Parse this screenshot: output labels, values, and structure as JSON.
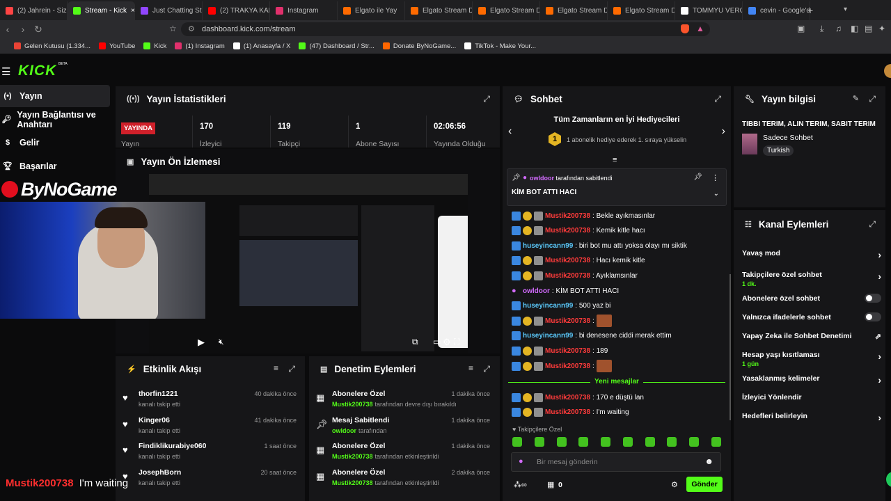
{
  "browser": {
    "tabs": [
      {
        "label": "(2) Jahrein - Siz B",
        "color": "#ff4444"
      },
      {
        "label": "Stream - Kick",
        "color": "#53fc18",
        "active": true
      },
      {
        "label": "Just Chatting Str",
        "color": "#9146ff"
      },
      {
        "label": "(2) TRAKYA KARS",
        "color": "#ff0000"
      },
      {
        "label": "Instagram",
        "color": "#e1306c"
      },
      {
        "label": "Elgato ile Yay",
        "color": "#ff6a00"
      },
      {
        "label": "Elgato Stream De",
        "color": "#ff6a00"
      },
      {
        "label": "Elgato Stream De",
        "color": "#ff6a00"
      },
      {
        "label": "Elgato Stream De",
        "color": "#ff6a00"
      },
      {
        "label": "Elgato Stream De",
        "color": "#ff6a00"
      },
      {
        "label": "TOMMYU VERCE",
        "color": "#ffffff"
      },
      {
        "label": "cevin - Google'd",
        "color": "#4285f4"
      }
    ],
    "url": "dashboard.kick.com/stream",
    "bookmarks": [
      {
        "label": "Gelen Kutusu (1.334...",
        "color": "#ea4335"
      },
      {
        "label": "YouTube",
        "color": "#ff0000"
      },
      {
        "label": "Kick",
        "color": "#53fc18"
      },
      {
        "label": "(1) Instagram",
        "color": "#e1306c"
      },
      {
        "label": "(1) Anasayfa / X",
        "color": "#ffffff"
      },
      {
        "label": "(47) Dashboard / Str...",
        "color": "#53fc18"
      },
      {
        "label": "Donate ByNoGame...",
        "color": "#ff6600"
      },
      {
        "label": "TikTok - Make Your...",
        "color": "#ffffff"
      }
    ]
  },
  "app": {
    "logo": "KICK",
    "beta": "BETA",
    "nav": [
      {
        "label": "Yayın",
        "icon": "broadcast-icon"
      },
      {
        "label": "Yayın Bağlantısı ve Anahtarı",
        "icon": "key-icon"
      },
      {
        "label": "Gelir",
        "icon": "dollar-icon"
      },
      {
        "label": "Başarılar",
        "icon": "trophy-icon"
      }
    ]
  },
  "stats": {
    "title": "Yayın İstatistikleri",
    "live_label": "YAYINDA",
    "live_caption": "Yayın",
    "items": [
      {
        "value": "170",
        "label": "İzleyici"
      },
      {
        "value": "119",
        "label": "Takipçi"
      },
      {
        "value": "1",
        "label": "Abone Sayısı"
      },
      {
        "value": "02:06:56",
        "label": "Yayında Olduğu"
      }
    ]
  },
  "preview": {
    "title": "Yayın Ön İzlemesi"
  },
  "overlay": {
    "brand": "ByNoGame",
    "chat_user": "Mustik200738",
    "chat_text": "I'm waiting"
  },
  "events": {
    "title": "Etkinlik Akışı",
    "items": [
      {
        "name": "thorfin1221",
        "sub": "kanalı takip etti",
        "time": "40 dakika önce"
      },
      {
        "name": "Kinger06",
        "sub": "kanalı takip etti",
        "time": "41 dakika önce"
      },
      {
        "name": "Findiklikurabiye060",
        "sub": "kanalı takip etti",
        "time": "1 saat önce"
      },
      {
        "name": "JosephBorn",
        "sub": "kanalı takip etti",
        "time": "20 saat önce"
      }
    ]
  },
  "moderation": {
    "title": "Denetim Eylemleri",
    "items": [
      {
        "name": "Abonelere Özel",
        "user": "Mustik200738",
        "rest": "tarafından devre dışı bırakıldı",
        "time": "1 dakika önce"
      },
      {
        "name": "Mesaj Sabitlendi",
        "user": "owldoor",
        "rest": "tarafından",
        "time": "1 dakika önce"
      },
      {
        "name": "Abonelere Özel",
        "user": "Mustik200738",
        "rest": "tarafından etkinleştirildi",
        "time": "1 dakika önce"
      },
      {
        "name": "Abonelere Özel",
        "user": "Mustik200738",
        "rest": "tarafından etkinleştirildi",
        "time": "2 dakika önce"
      }
    ]
  },
  "chat": {
    "title": "Sohbet",
    "gifters_title": "Tüm Zamanların en İyi Hediyecileri",
    "gifters_text": "1 abonelik hediye ederek 1. sıraya yükselin",
    "gifters_rank": "1",
    "pinned_by_user": "owldoor",
    "pinned_by_rest": "tarafından sabitlendi",
    "pinned_text": "KİM BOT ATTI HACI",
    "messages": [
      {
        "user": "Mustik200738",
        "cls": "red",
        "text": ": Bekle ayıkmasınlar"
      },
      {
        "user": "Mustik200738",
        "cls": "red",
        "text": ": Kemik kitle hacı"
      },
      {
        "user": "huseyincann99",
        "cls": "blue",
        "text": ": biri bot mu attı yoksa olayı mı siktik"
      },
      {
        "user": "Mustik200738",
        "cls": "red",
        "text": ": Hacı kemik kitle"
      },
      {
        "user": "Mustik200738",
        "cls": "red",
        "text": ": Ayıklamsınlar"
      },
      {
        "user": "owldoor",
        "cls": "purp",
        "text": ": KİM BOT ATTI HACI"
      },
      {
        "user": "huseyincann99",
        "cls": "blue",
        "text": ": 500 yaz bi"
      },
      {
        "user": "Mustik200738",
        "cls": "red",
        "text": ":",
        "emote": true
      },
      {
        "user": "huseyincann99",
        "cls": "blue",
        "text": ": bi denesene ciddi merak ettim"
      },
      {
        "user": "Mustik200738",
        "cls": "red",
        "text": ": 189"
      },
      {
        "user": "Mustik200738",
        "cls": "red",
        "text": ":",
        "emote": true
      }
    ],
    "new_messages_label": "Yeni mesajlar",
    "messages_after": [
      {
        "user": "Mustik200738",
        "cls": "red",
        "text": ": 170 e düştü lan"
      },
      {
        "user": "Mustik200738",
        "cls": "red",
        "text": ": I'm waiting"
      }
    ],
    "followers_only": "Takipçilere Özel",
    "input_placeholder": "Bir mesaj gönderin",
    "points": "0",
    "send_label": "Gönder"
  },
  "stream_info": {
    "title": "Yayın bilgisi",
    "stream_title": "TIBBI TERIM, ALIN TERIM, SABIT TERIM",
    "category": "Sadece Sohbet",
    "language": "Turkish"
  },
  "channel_actions": {
    "title": "Kanal Eylemleri",
    "items": [
      {
        "label": "Yavaş mod",
        "control": "chevron"
      },
      {
        "label": "Takipçilere özel sohbet",
        "sub": "1 dk.",
        "control": "chevron"
      },
      {
        "label": "Abonelere özel sohbet",
        "control": "toggle"
      },
      {
        "label": "Yalnızca ifadelerle sohbet",
        "control": "toggle"
      },
      {
        "label": "Yapay Zeka ile Sohbet Denetimi",
        "control": "external"
      },
      {
        "label": "Hesap yaşı kısıtlaması",
        "sub": "1 gün",
        "control": "chevron"
      },
      {
        "label": "Yasaklanmış kelimeler",
        "control": "chevron"
      },
      {
        "label": "İzleyici Yönlendir",
        "control": "none"
      },
      {
        "label": "Hedefleri belirleyin",
        "control": "chevron"
      }
    ]
  }
}
